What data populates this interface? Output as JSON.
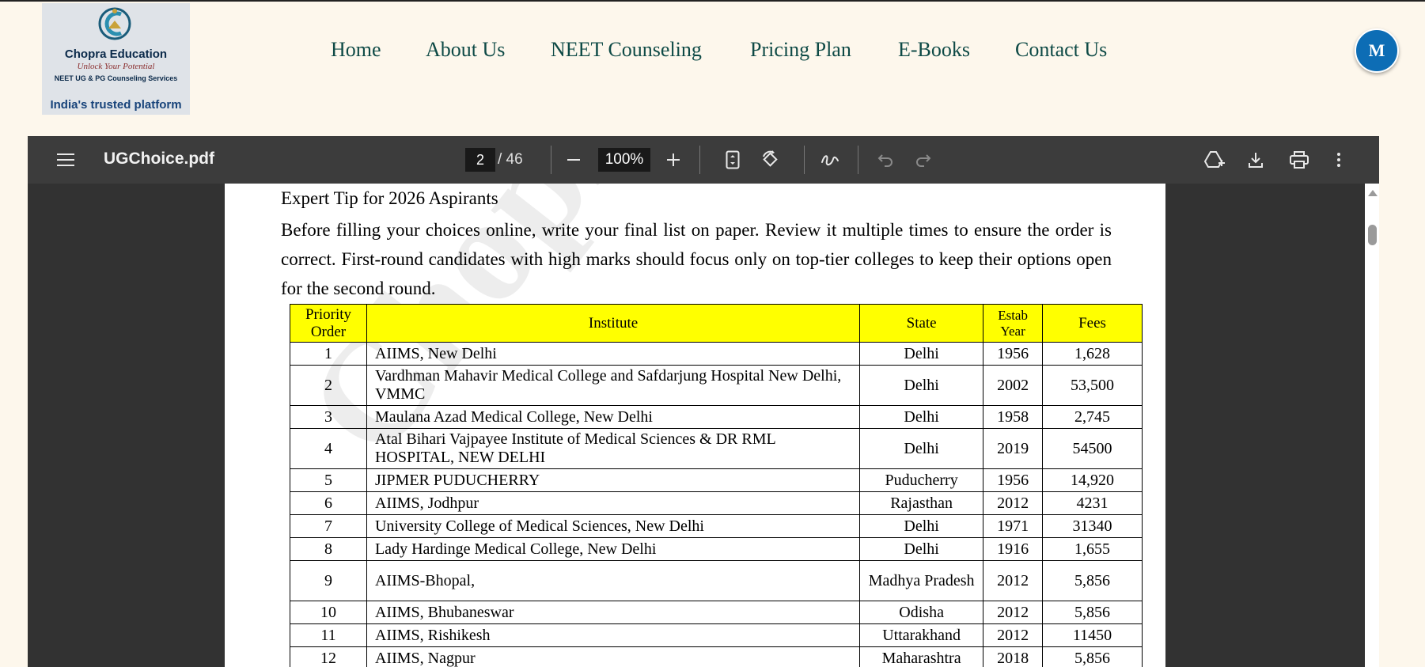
{
  "brand": {
    "name": "Chopra Education",
    "tagline": "Unlock Your Potential",
    "services": "NEET UG & PG Counseling Services",
    "trust": "India's trusted platform"
  },
  "nav": [
    "Home",
    "About Us",
    "NEET Counseling",
    "Pricing Plan",
    "E-Books",
    "Contact Us"
  ],
  "user": {
    "avatar_letter": "M"
  },
  "viewer": {
    "file_name": "UGChoice.pdf",
    "current_page": "2",
    "total_pages": "/ 46",
    "zoom": "100%"
  },
  "document": {
    "watermark": "Chopra E",
    "tip_title": "Expert Tip for 2026 Aspirants",
    "tip_body": "Before filling your choices online, write your final list on paper. Review it multiple times to ensure the order is correct. First-round candidates with high marks should focus only on top-tier colleges to keep their options open for the second round.",
    "table": {
      "headers": [
        "Priority Order",
        "Institute",
        "State",
        "Estab Year",
        "Fees"
      ],
      "rows": [
        [
          "1",
          "AIIMS, New Delhi",
          "Delhi",
          "1956",
          "1,628"
        ],
        [
          "2",
          "Vardhman Mahavir Medical College and Safdarjung Hospital New Delhi, VMMC",
          "Delhi",
          "2002",
          "53,500"
        ],
        [
          "3",
          "Maulana Azad Medical College, New Delhi",
          "Delhi",
          "1958",
          "2,745"
        ],
        [
          "4",
          "Atal Bihari Vajpayee Institute of Medical Sciences & DR RML HOSPITAL, NEW DELHI",
          "Delhi",
          "2019",
          "54500"
        ],
        [
          "5",
          "JIPMER PUDUCHERRY",
          "Puducherry",
          "1956",
          "14,920"
        ],
        [
          "6",
          "AIIMS, Jodhpur",
          "Rajasthan",
          "2012",
          "4231"
        ],
        [
          "7",
          "University College of Medical Sciences, New Delhi",
          "Delhi",
          "1971",
          "31340"
        ],
        [
          "8",
          "Lady Hardinge Medical College, New Delhi",
          "Delhi",
          "1916",
          "1,655"
        ],
        [
          "9",
          "AIIMS-Bhopal,",
          "Madhya Pradesh",
          "2012",
          "5,856"
        ],
        [
          "10",
          "AIIMS, Bhubaneswar",
          "Odisha",
          "2012",
          "5,856"
        ],
        [
          "11",
          "AIIMS, Rishikesh",
          "Uttarakhand",
          "2012",
          "11450"
        ],
        [
          "12",
          "AIIMS, Nagpur",
          "Maharashtra",
          "2018",
          "5,856"
        ]
      ]
    }
  }
}
